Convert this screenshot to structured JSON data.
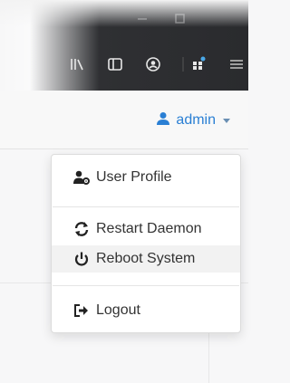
{
  "header": {
    "user_name": "admin"
  },
  "menu": {
    "items": [
      {
        "label": "User Profile",
        "icon": "user-cog-icon"
      },
      {
        "label": "Restart Daemon",
        "icon": "refresh-icon"
      },
      {
        "label": "Reboot System",
        "icon": "power-icon"
      },
      {
        "label": "Logout",
        "icon": "sign-out-icon"
      }
    ]
  },
  "toolbar": {
    "icons": [
      "library-icon",
      "sidebar-icon",
      "account-icon",
      "extensions-icon",
      "menu-icon"
    ]
  },
  "colors": {
    "accent": "#2a7fd4",
    "toolbar_bg": "#2a2b2e",
    "menu_text": "#333333"
  }
}
